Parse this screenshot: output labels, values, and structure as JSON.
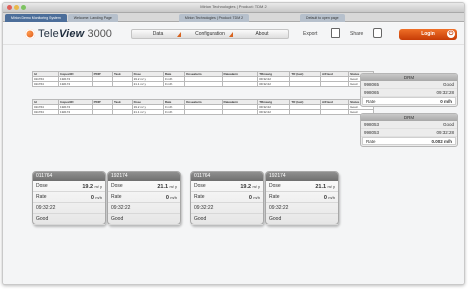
{
  "window": {
    "title": "Mirion Technologies | Product: TDM 2",
    "tabs": [
      {
        "label": "Mirion Demo Monitoring System"
      },
      {
        "label": "Welcome: Landing Page"
      },
      {
        "label": "Mirion Technologies | Product: TDM 2"
      },
      {
        "label": "Default to open page"
      }
    ]
  },
  "brand": {
    "name_prefix": "Tele",
    "name_bold": "View",
    "version": "3000"
  },
  "nav": {
    "data": "Data",
    "configuration": "Configuration",
    "about": "About"
  },
  "toolbar": {
    "export": "Export",
    "share": "Share",
    "login": "Login"
  },
  "colors": {
    "accent": "#d44a0c",
    "card_header": "#7b7b7b"
  },
  "table1": {
    "headers": [
      "Id",
      "InspectID",
      "PDIP",
      "Task",
      "Dose",
      "Rate",
      "Dosealarm",
      "Ratealarm",
      "TRmastg",
      "TR (last)",
      "A/Fixed",
      "Status"
    ],
    "rows": [
      [
        "011764",
        "192174",
        "",
        "",
        "19.2 m/ y",
        "0 m/h",
        "",
        "",
        "09:32:22",
        "",
        "",
        "Good"
      ],
      [
        "011764",
        "192174",
        "",
        "",
        "21.1 m/ y",
        "0 m/h",
        "",
        "",
        "09:32:22",
        "",
        "",
        "Good"
      ]
    ]
  },
  "table2": {
    "headers": [
      "Id",
      "InspectID",
      "PDIP",
      "Task",
      "Dose",
      "Rate",
      "Dosealarm",
      "Ratealarm",
      "TRmastg",
      "TR (last)",
      "A/Fixed",
      "Status"
    ],
    "rows": [
      [
        "011764",
        "192174",
        "",
        "",
        "19.2 m/ y",
        "0 m/h",
        "",
        "",
        "09:32:22",
        "",
        "",
        "Good"
      ],
      [
        "011764",
        "192174",
        "",
        "",
        "21.1 m/ y",
        "0 m/h",
        "",
        "",
        "09:32:22",
        "",
        "",
        "Good"
      ]
    ]
  },
  "drm_panels": [
    {
      "title": "DRM",
      "id": "998065",
      "status": "Good",
      "sub_id": "998065",
      "time": "09:32:28",
      "rate_label": "Rate",
      "rate_value": "0 m/h"
    },
    {
      "title": "DRM",
      "id": "998053",
      "status": "Good",
      "sub_id": "998053",
      "time": "09:32:28",
      "rate_label": "Rate",
      "rate_value": "0.002 m/h"
    }
  ],
  "cards": [
    {
      "id": "011764",
      "dose_label": "Dose",
      "dose_value": "19.2",
      "dose_unit": "m/ y",
      "rate_label": "Rate",
      "rate_value": "0",
      "rate_unit": "m/h",
      "time": "09:32:22",
      "status": "Good"
    },
    {
      "id": "192174",
      "dose_label": "Dose",
      "dose_value": "21.1",
      "dose_unit": "m/ y",
      "rate_label": "Rate",
      "rate_value": "0",
      "rate_unit": "m/h",
      "time": "09:32:22",
      "status": "Good"
    },
    {
      "id": "011764",
      "dose_label": "Dose",
      "dose_value": "19.2",
      "dose_unit": "m/ y",
      "rate_label": "Rate",
      "rate_value": "0",
      "rate_unit": "m/h",
      "time": "09:32:22",
      "status": "Good"
    },
    {
      "id": "192174",
      "dose_label": "Dose",
      "dose_value": "21.1",
      "dose_unit": "m/ y",
      "rate_label": "Rate",
      "rate_value": "0",
      "rate_unit": "m/h",
      "time": "09:32:22",
      "status": "Good"
    }
  ]
}
